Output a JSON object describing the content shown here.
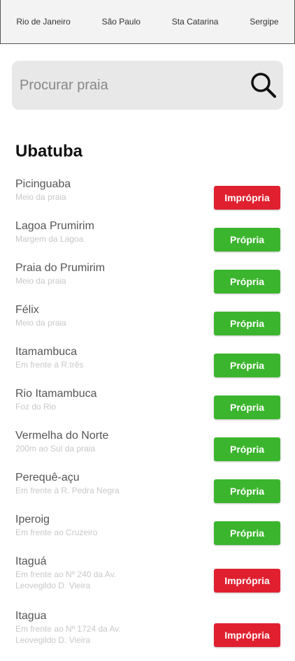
{
  "tabs": [
    "Rio de Janeiro",
    "São Paulo",
    "Sta Catarina",
    "Sergipe"
  ],
  "search": {
    "placeholder": "Procurar praia"
  },
  "city": "Ubatuba",
  "colors": {
    "propria": "#3cb52e",
    "impropria": "#e0202f",
    "search_bg": "#e8e8e8"
  },
  "beaches": [
    {
      "name": "Picinguaba",
      "location": "Meio da praia",
      "status": "Imprópria"
    },
    {
      "name": "Lagoa Prumirim",
      "location": "Margem da Lagoa",
      "status": "Própria"
    },
    {
      "name": "Praia do Prumirim",
      "location": "Meio da praia",
      "status": "Própria"
    },
    {
      "name": "Félix",
      "location": "Meio da praia",
      "status": "Própria"
    },
    {
      "name": "Itamambuca",
      "location": "Em frente à R.três",
      "status": "Própria"
    },
    {
      "name": "Rio Itamambuca",
      "location": "Foz do Rio",
      "status": "Própria"
    },
    {
      "name": "Vermelha do Norte",
      "location": "200m ao Sul da praia",
      "status": "Própria"
    },
    {
      "name": "Perequê-açu",
      "location": "Em frente à R. Pedra Negra",
      "status": "Própria"
    },
    {
      "name": "Iperoig",
      "location": "Em frente ao Cruzeiro",
      "status": "Própria"
    },
    {
      "name": "Itaguá",
      "location": "Em frente ao Nº 240 da Av. Leovegildo D. Vieira",
      "status": "Imprópria"
    },
    {
      "name": "Itagua",
      "location": "Em frente ao Nº 1724 da Av. Leovegildo D. Vieira",
      "status": "Imprópria"
    }
  ]
}
